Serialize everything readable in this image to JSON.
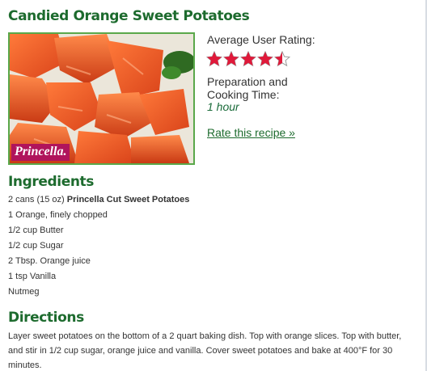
{
  "recipe": {
    "title": "Candied Orange Sweet Potatoes",
    "image_brand": "Princella.",
    "rating_label": "Average User Rating:",
    "rating_value": 4.5,
    "rating_max": 5,
    "prep_label": "Preparation and Cooking Time:",
    "prep_value": "1 hour",
    "rate_link": "Rate this recipe »"
  },
  "ingredients": {
    "heading": "Ingredients",
    "items": [
      {
        "text": "2 cans (15 oz) ",
        "bold": "Princella Cut Sweet Potatoes"
      },
      {
        "text": "1 Orange, finely chopped",
        "bold": ""
      },
      {
        "text": "1/2 cup Butter",
        "bold": ""
      },
      {
        "text": "1/2 cup Sugar",
        "bold": ""
      },
      {
        "text": "2 Tbsp. Orange juice",
        "bold": ""
      },
      {
        "text": "1 tsp Vanilla",
        "bold": ""
      },
      {
        "text": "Nutmeg",
        "bold": ""
      }
    ]
  },
  "directions": {
    "heading": "Directions",
    "text": "Layer sweet potatoes on the bottom of a 2 quart baking dish. Top with orange slices. Top with butter, and stir in 1/2 cup sugar, orange juice and vanilla. Cover sweet potatoes and bake at 400°F for 30 minutes."
  },
  "colors": {
    "heading": "#1d6b2e",
    "star": "#e0193a",
    "brand_bg": "#b0145c",
    "photo_border": "#5aa84a"
  },
  "icons": {
    "star": "star-icon",
    "half_star": "half-star-icon"
  }
}
